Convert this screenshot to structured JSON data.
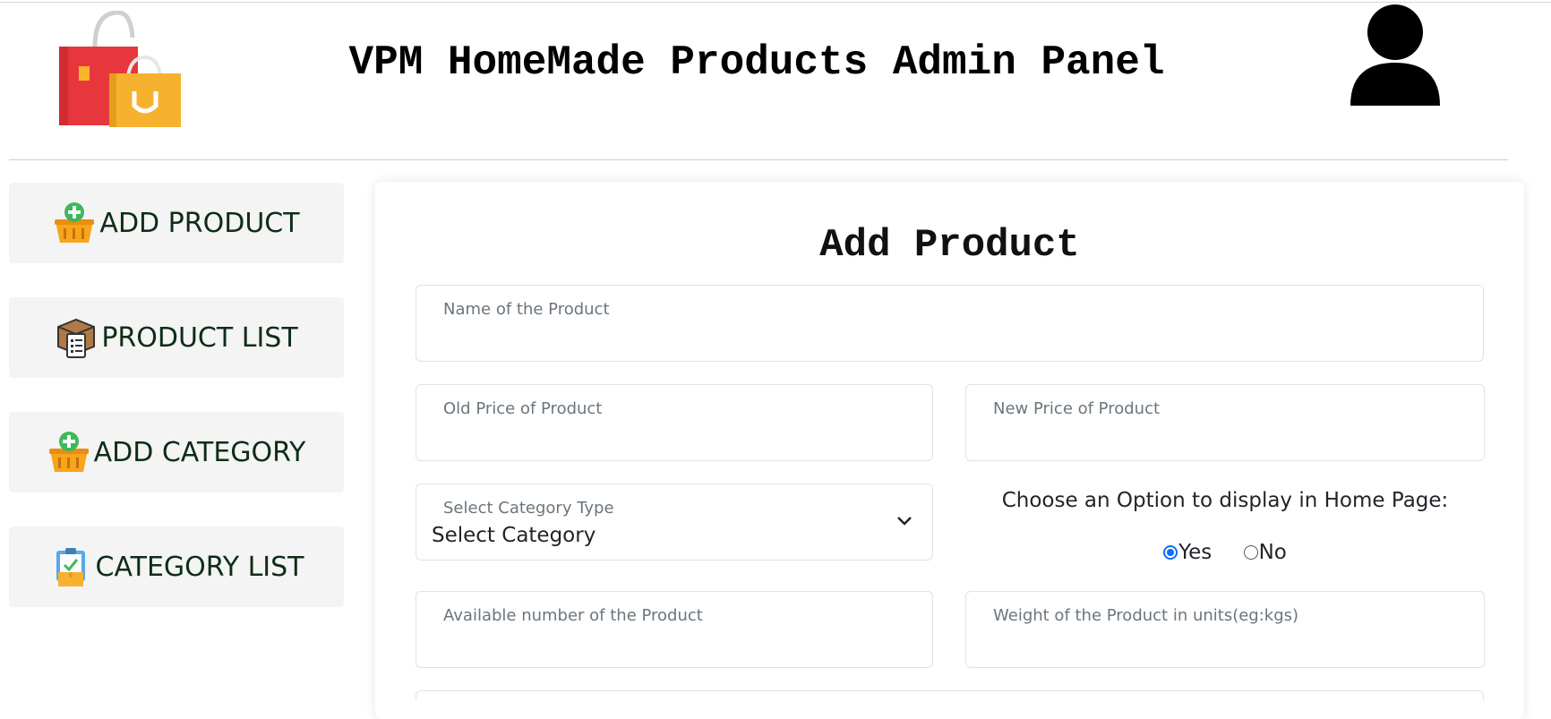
{
  "header": {
    "title": "VPM HomeMade Products Admin Panel",
    "logo_icon": "shopping-bags-icon",
    "avatar_icon": "user-avatar-icon"
  },
  "sidebar": {
    "items": [
      {
        "label": "ADD PRODUCT",
        "icon": "add-basket-icon"
      },
      {
        "label": "PRODUCT LIST",
        "icon": "box-checklist-icon"
      },
      {
        "label": "ADD CATEGORY",
        "icon": "add-basket-icon"
      },
      {
        "label": "CATEGORY LIST",
        "icon": "clipboard-box-icon"
      }
    ]
  },
  "form": {
    "title": "Add Product",
    "name_label": "Name of the Product",
    "old_price_label": "Old Price of Product",
    "new_price_label": "New Price of Product",
    "category_label": "Select Category Type",
    "category_value": "Select Category",
    "display_question": "Choose an Option to display in Home Page:",
    "radio_yes": "Yes",
    "radio_no": "No",
    "radio_selected": "Yes",
    "available_label": "Available number of the Product",
    "weight_label": "Weight of the Product in units(eg:kgs)"
  },
  "colors": {
    "accent": "#0d6efd",
    "sidebar_text": "#0e2d17",
    "sidebar_bg": "#f4f4f4"
  }
}
